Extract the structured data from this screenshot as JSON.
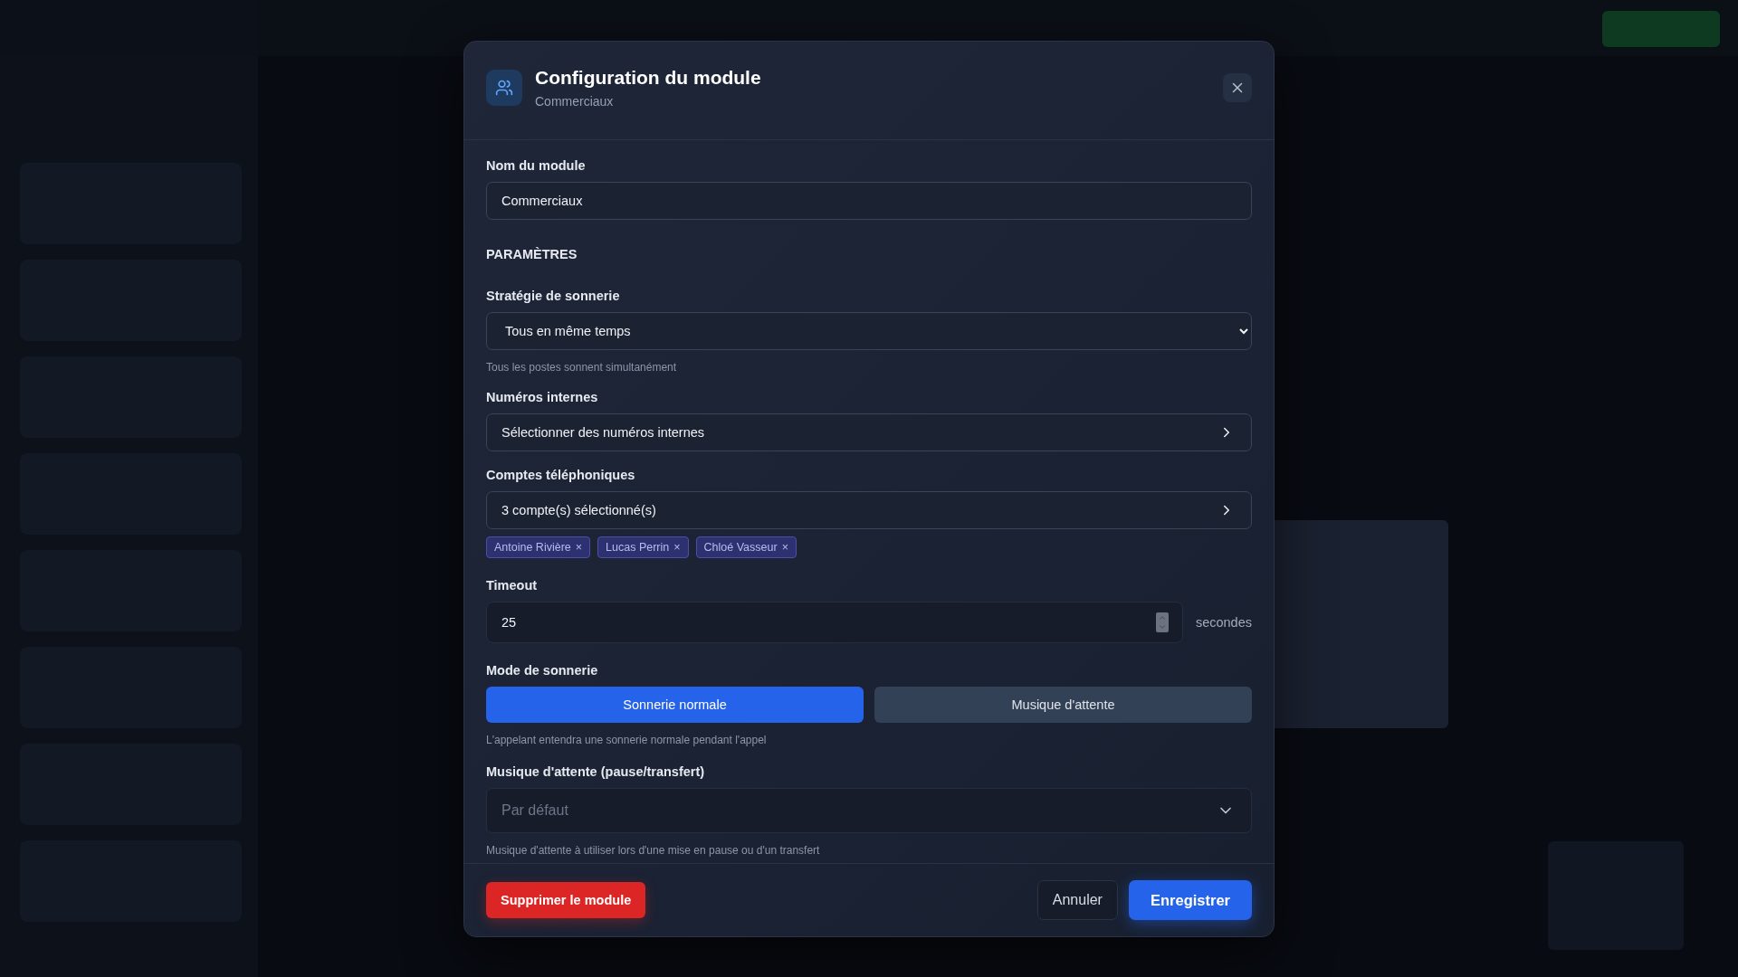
{
  "dialog": {
    "title": "Configuration du module",
    "subtitle": "Commerciaux"
  },
  "name_field": {
    "label": "Nom du module",
    "value": "Commerciaux"
  },
  "section_heading": "PARAMÈTRES",
  "strategy": {
    "label": "Stratégie de sonnerie",
    "value": "Tous en même temps",
    "hint": "Tous les postes sonnent simultanément"
  },
  "internal_numbers": {
    "label": "Numéros internes",
    "value": "Sélectionner des numéros internes"
  },
  "accounts": {
    "label": "Comptes téléphoniques",
    "value": "3 compte(s) sélectionné(s)",
    "tags": [
      {
        "label": "Antoine Rivière",
        "remove": "×"
      },
      {
        "label": "Lucas Perrin",
        "remove": "×"
      },
      {
        "label": "Chloé Vasseur",
        "remove": "×"
      }
    ]
  },
  "timeout": {
    "label": "Timeout",
    "value": "25",
    "unit": "secondes"
  },
  "ring_mode": {
    "label": "Mode de sonnerie",
    "options": [
      {
        "label": "Sonnerie normale",
        "selected": true
      },
      {
        "label": "Musique d'attente",
        "selected": false
      }
    ],
    "hint": "L'appelant entendra une sonnerie normale pendant l'appel"
  },
  "hold_music": {
    "label": "Musique d'attente (pause/transfert)",
    "placeholder": "Par défaut",
    "hint": "Musique d'attente à utiliser lors d'une mise en pause ou d'un transfert"
  },
  "footer": {
    "delete": "Supprimer le module",
    "cancel": "Annuler",
    "save": "Enregistrer"
  }
}
